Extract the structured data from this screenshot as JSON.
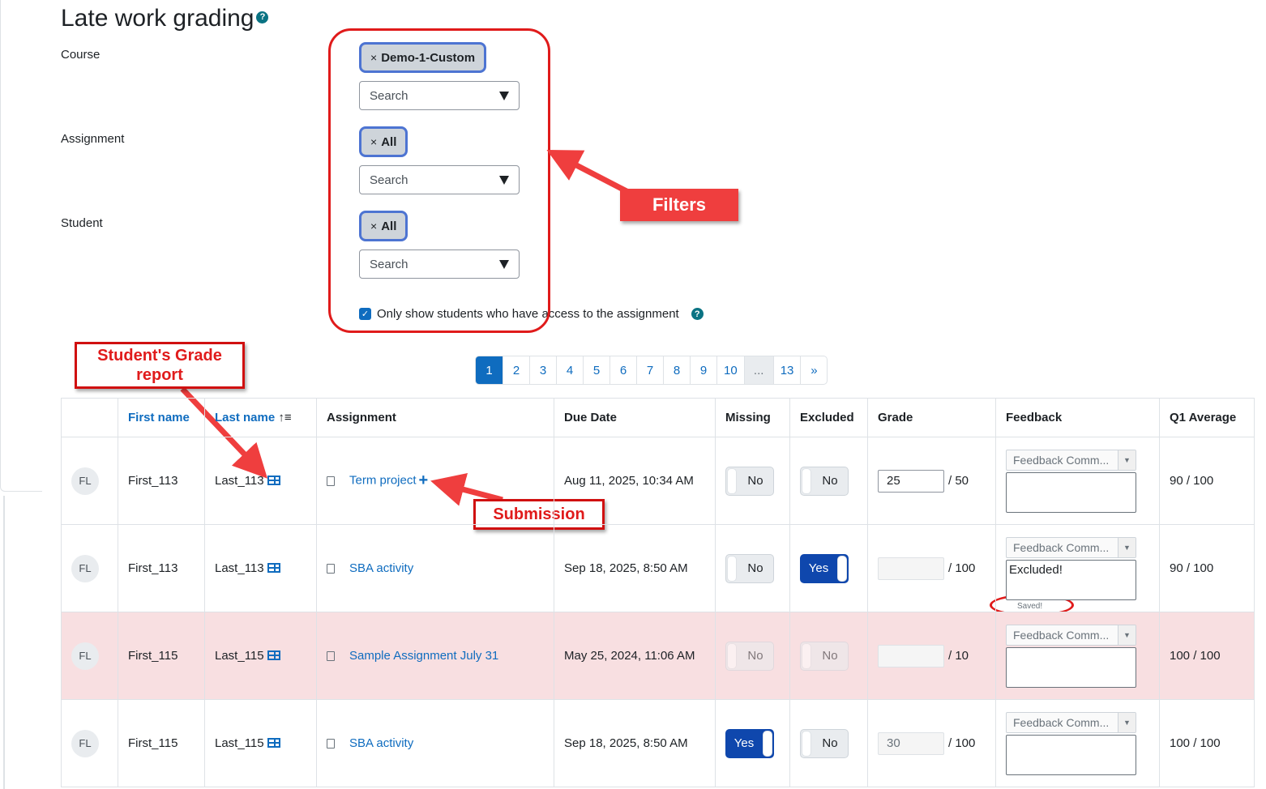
{
  "page": {
    "title": "Late work grading"
  },
  "filters": {
    "course_label": "Course",
    "course_chip": "Demo-1-Custom",
    "assignment_label": "Assignment",
    "assignment_chip": "All",
    "student_label": "Student",
    "student_chip": "All",
    "search_placeholder": "Search",
    "only_access_label": "Only show students who have access to the assignment"
  },
  "annotations": {
    "filters": "Filters",
    "grade_report_line1": "Student's Grade",
    "grade_report_line2": "report",
    "submission": "Submission"
  },
  "pagination": [
    "1",
    "2",
    "3",
    "4",
    "5",
    "6",
    "7",
    "8",
    "9",
    "10",
    "...",
    "13",
    "»"
  ],
  "table": {
    "headers": {
      "first_name": "First name",
      "last_name": "Last name",
      "assignment": "Assignment",
      "due_date": "Due Date",
      "missing": "Missing",
      "excluded": "Excluded",
      "grade": "Grade",
      "feedback": "Feedback",
      "q1_average": "Q1 Average"
    },
    "feedback_placeholder": "Feedback Comm...",
    "saved_text": "Saved!",
    "rows": [
      {
        "initials": "FL",
        "first": "First_113",
        "last": "Last_113",
        "assignment": "Term project",
        "due": "Aug 11, 2025, 10:34 AM",
        "missing": "No",
        "excluded": "No",
        "grade": "25",
        "max": "/ 50",
        "feedback": "",
        "avg": "90 / 100"
      },
      {
        "initials": "FL",
        "first": "First_113",
        "last": "Last_113",
        "assignment": "SBA activity",
        "due": "Sep 18, 2025, 8:50 AM",
        "missing": "No",
        "excluded": "Yes",
        "grade": "",
        "max": "/ 100",
        "feedback": "Excluded!",
        "avg": "90 / 100"
      },
      {
        "initials": "FL",
        "first": "First_115",
        "last": "Last_115",
        "assignment": "Sample Assignment July 31",
        "due": "May 25, 2024, 11:06 AM",
        "missing": "No",
        "excluded": "No",
        "grade": "",
        "max": "/ 10",
        "feedback": "",
        "avg": "100 / 100"
      },
      {
        "initials": "FL",
        "first": "First_115",
        "last": "Last_115",
        "assignment": "SBA activity",
        "due": "Sep 18, 2025, 8:50 AM",
        "missing": "Yes",
        "excluded": "No",
        "grade": "30",
        "max": "/ 100",
        "feedback": "",
        "avg": "100 / 100"
      }
    ]
  }
}
